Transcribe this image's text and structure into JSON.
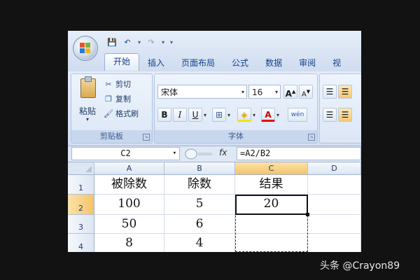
{
  "quick_access": {
    "save": "💾",
    "undo": "↶",
    "redo": "↷",
    "customize": "▾"
  },
  "tabs": [
    "开始",
    "插入",
    "页面布局",
    "公式",
    "数据",
    "审阅",
    "视"
  ],
  "clipboard": {
    "paste_label": "粘贴",
    "paste_arrow": "▾",
    "items": [
      {
        "icon": "✂",
        "label": "剪切"
      },
      {
        "icon": "❐",
        "label": "复制"
      },
      {
        "icon": "🖌",
        "label": "格式刷"
      }
    ],
    "group_label": "剪贴板"
  },
  "font": {
    "name": "宋体",
    "size": "16",
    "grow": "A",
    "shrink": "A",
    "bold": "B",
    "italic": "I",
    "underline": "U",
    "border_icon": "⊞",
    "fill_icon": "◈",
    "font_color_icon": "A",
    "phonetic_icon": "wén",
    "group_label": "字体"
  },
  "formula_bar": {
    "cell_ref": "C2",
    "fx": "fx",
    "formula": "=A2/B2"
  },
  "sheet": {
    "columns": [
      "A",
      "B",
      "C",
      "D"
    ],
    "rows": [
      {
        "num": "1",
        "cells": [
          "被除数",
          "除数",
          "结果",
          ""
        ]
      },
      {
        "num": "2",
        "cells": [
          "100",
          "5",
          "20",
          ""
        ]
      },
      {
        "num": "3",
        "cells": [
          "50",
          "6",
          "",
          ""
        ]
      },
      {
        "num": "4",
        "cells": [
          "8",
          "4",
          "",
          ""
        ]
      }
    ]
  },
  "watermark": "头条 @Crayon89"
}
